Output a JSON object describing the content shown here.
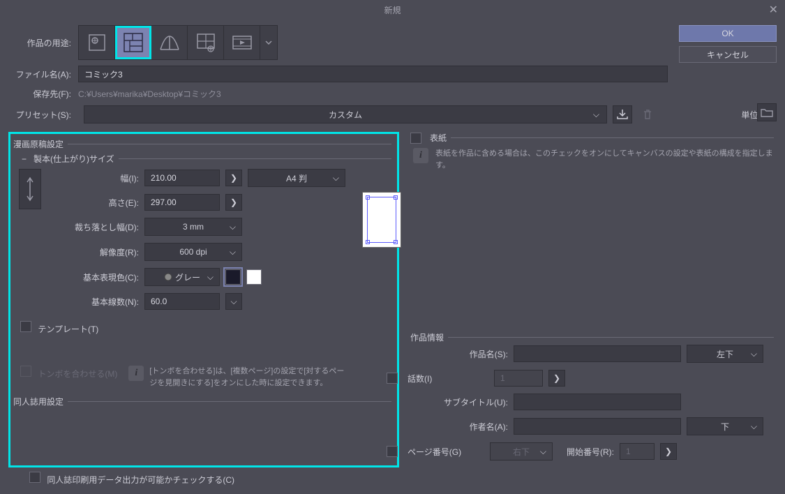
{
  "window": {
    "title": "新規"
  },
  "buttons": {
    "ok": "OK",
    "cancel": "キャンセル"
  },
  "labels": {
    "purpose": "作品の用途:",
    "filename": "ファイル名(A):",
    "saveto": "保存先(F):",
    "preset": "プリセット(S):",
    "unit": "単位: mm"
  },
  "fields": {
    "filename": "コミック3",
    "saveto": "C:¥Users¥marika¥Desktop¥コミック3",
    "preset": "カスタム"
  },
  "manga": {
    "groupTitle": "漫画原稿設定",
    "bindingTitle": "製本(仕上がり)サイズ",
    "widthLabel": "幅(I):",
    "width": "210.00",
    "heightLabel": "高さ(E):",
    "height": "297.00",
    "pageSize": "A4 判",
    "bleedLabel": "裁ち落とし幅(D):",
    "bleed": "3 mm",
    "resLabel": "解像度(R):",
    "res": "600 dpi",
    "colorLabel": "基本表現色(C):",
    "color": "グレー",
    "linesLabel": "基本線数(N):",
    "lines": "60.0",
    "templateLabel": "テンプレート(T)",
    "tomboLabel": "トンボを合わせる(M)",
    "tomboInfo": "[トンボを合わせる]は、[複数ページ]の設定で[対するページを見開きにする]をオンにした時に設定できます。"
  },
  "doujin": {
    "groupTitle": "同人誌用設定",
    "checkLabel": "同人誌印刷用データ出力が可能かチェックする(C)"
  },
  "cover": {
    "title": "表紙",
    "info": "表紙を作品に含める場合は、このチェックをオンにしてキャンバスの設定や表紙の構成を指定します。"
  },
  "workinfo": {
    "title": "作品情報",
    "nameLabel": "作品名(S):",
    "name": "",
    "posName": "左下",
    "episodeLabel": "話数(I)",
    "episode": "1",
    "subtitleLabel": "サブタイトル(U):",
    "subtitle": "",
    "authorLabel": "作者名(A):",
    "author": "",
    "posAuthor": "下",
    "pageLabel": "ページ番号(G)",
    "pagePos": "右下",
    "startLabel": "開始番号(R):",
    "start": "1"
  }
}
